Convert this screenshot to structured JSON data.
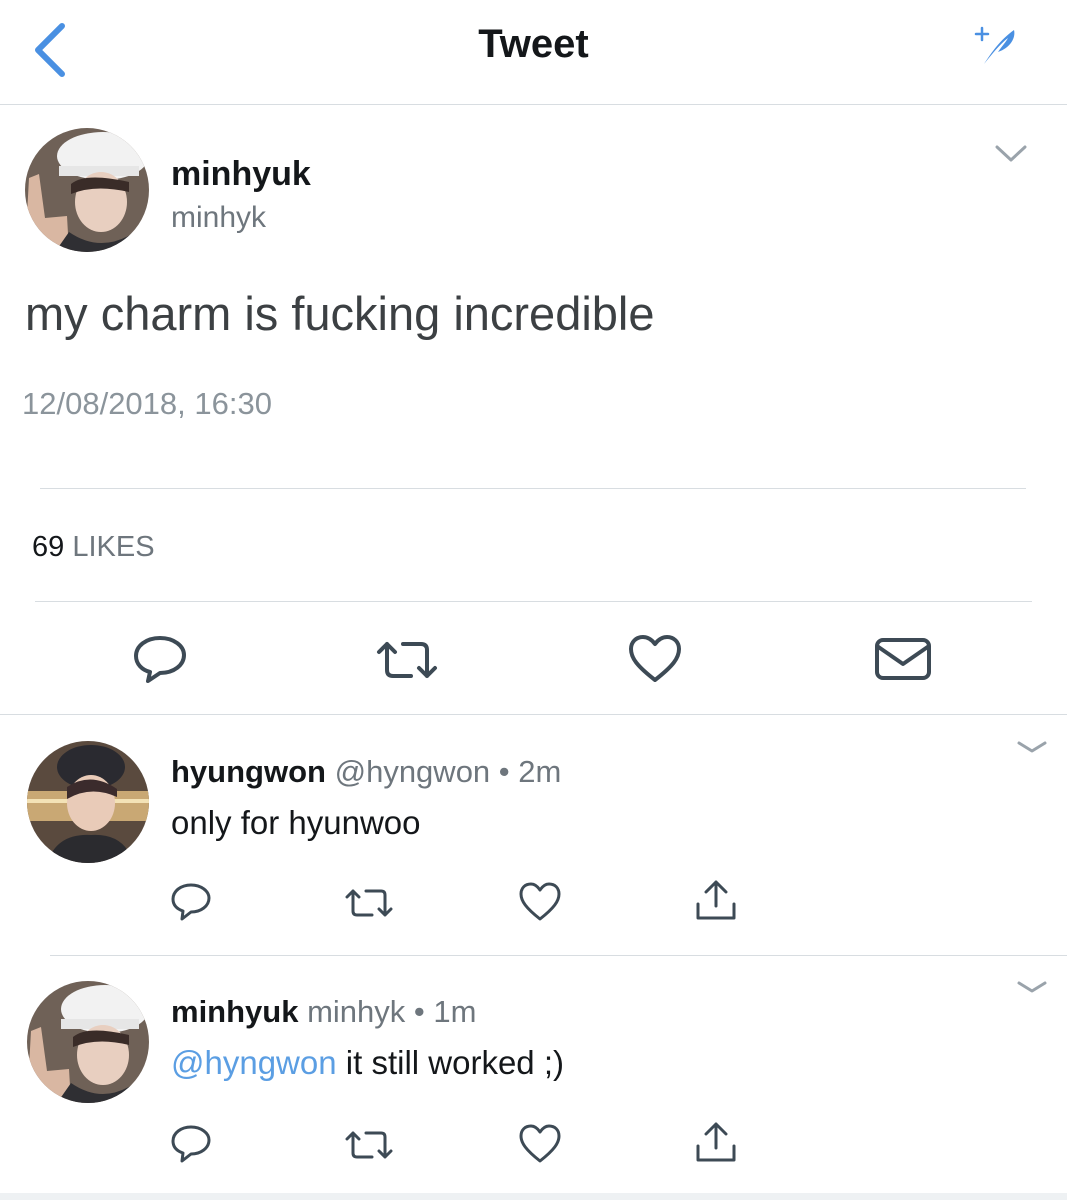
{
  "header": {
    "title": "Tweet",
    "back_icon": "chevron-left-icon",
    "compose_icon": "compose-tweet-icon",
    "accent_color": "#4a90e2"
  },
  "main_tweet": {
    "display_name": "minhyuk",
    "handle": "minhyk",
    "text": "my charm is fucking incredible",
    "timestamp": "12/08/2018, 16:30",
    "likes_count": "69",
    "likes_label": "LIKES",
    "actions": [
      "reply-icon",
      "retweet-icon",
      "like-icon",
      "direct-message-icon"
    ]
  },
  "replies": [
    {
      "display_name": "hyungwon",
      "handle": "@hyngwon",
      "separator": "•",
      "time": "2m",
      "mention": "",
      "text": "only for hyunwoo",
      "actions": [
        "reply-icon",
        "retweet-icon",
        "like-icon",
        "share-icon"
      ]
    },
    {
      "display_name": "minhyuk",
      "handle": "minhyk",
      "separator": "•",
      "time": "1m",
      "mention": "@hyngwon",
      "text": " it still worked ;)",
      "actions": [
        "reply-icon",
        "retweet-icon",
        "like-icon",
        "share-icon"
      ]
    }
  ]
}
